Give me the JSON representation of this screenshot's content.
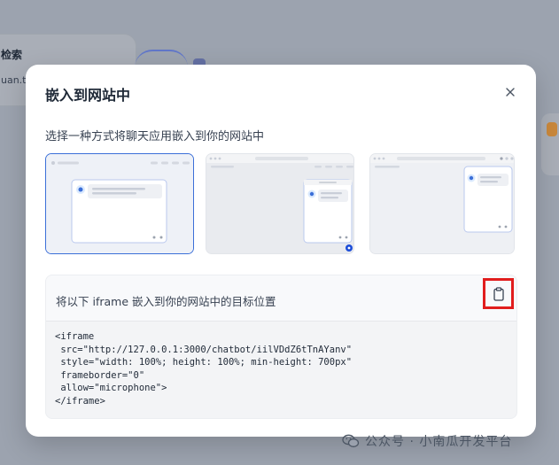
{
  "background": {
    "node_title": "检索",
    "node_file": "uan.tx"
  },
  "modal": {
    "title": "嵌入到网站中",
    "close_icon": "close-icon",
    "subtitle": "选择一种方式将聊天应用嵌入到你的网站中",
    "options": [
      {
        "name": "fullpage",
        "selected": true
      },
      {
        "name": "floating-bubble",
        "selected": false
      },
      {
        "name": "chrome-extension",
        "selected": false
      }
    ],
    "embed": {
      "label": "将以下 iframe 嵌入到你的网站中的目标位置",
      "copy_icon": "clipboard-icon",
      "code_lines": [
        "<iframe",
        " src=\"http://127.0.0.1:3000/chatbot/iilVDdZ6tTnAYanv\"",
        " style=\"width: 100%; height: 100%; min-height: 700px\"",
        " frameborder=\"0\"",
        " allow=\"microphone\">",
        "</iframe>"
      ]
    }
  },
  "watermark": {
    "text": "公众号 · 小南瓜开发平台",
    "icon": "wechat-icon"
  },
  "colors": {
    "accent": "#3b6fd8",
    "highlight": "#e11d1d",
    "overlay": "#9ca3af"
  }
}
